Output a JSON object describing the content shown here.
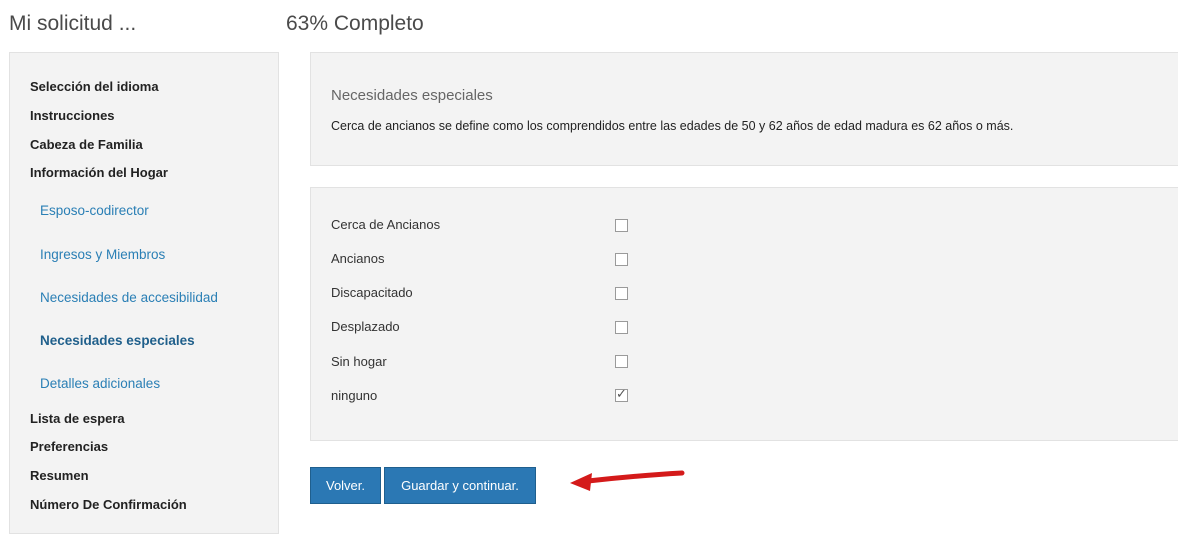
{
  "header": {
    "sidebar_title": "Mi solicitud ...",
    "progress": "63% Completo"
  },
  "sidebar": {
    "items": [
      {
        "label": "Selección del idioma",
        "level": 1
      },
      {
        "label": "Instrucciones",
        "level": 1
      },
      {
        "label": "Cabeza de Familia",
        "level": 1
      },
      {
        "label": "Información del Hogar",
        "level": 1
      },
      {
        "label": "Esposo-codirector",
        "level": 2
      },
      {
        "label": "Ingresos y Miembros",
        "level": 2
      },
      {
        "label": "Necesidades de accesibilidad",
        "level": 2
      },
      {
        "label": "Necesidades especiales",
        "level": 2,
        "active": true
      },
      {
        "label": "Detalles adicionales",
        "level": 2
      },
      {
        "label": "Lista de espera",
        "level": 1
      },
      {
        "label": "Preferencias",
        "level": 1
      },
      {
        "label": "Resumen",
        "level": 1
      },
      {
        "label": "Número De Confirmación",
        "level": 1
      }
    ]
  },
  "main": {
    "section_title": "Necesidades especiales",
    "description": "Cerca de ancianos se define como los comprendidos entre las edades de 50 y 62 años de edad madura es 62 años o más.",
    "options": [
      {
        "label": "Cerca de Ancianos",
        "checked": false
      },
      {
        "label": "Ancianos",
        "checked": false
      },
      {
        "label": "Discapacitado",
        "checked": false
      },
      {
        "label": "Desplazado",
        "checked": false
      },
      {
        "label": "Sin hogar",
        "checked": false
      },
      {
        "label": "ninguno",
        "checked": true
      }
    ]
  },
  "buttons": {
    "back": "Volver.",
    "save": "Guardar y continuar."
  },
  "colors": {
    "button_bg": "#2b78b4",
    "link": "#2a7fb5",
    "arrow": "#d41a1a",
    "panel_bg": "#f3f3f3"
  },
  "icons": {
    "annotation": "red-arrow-icon",
    "checkmark": "checkmark-icon"
  }
}
